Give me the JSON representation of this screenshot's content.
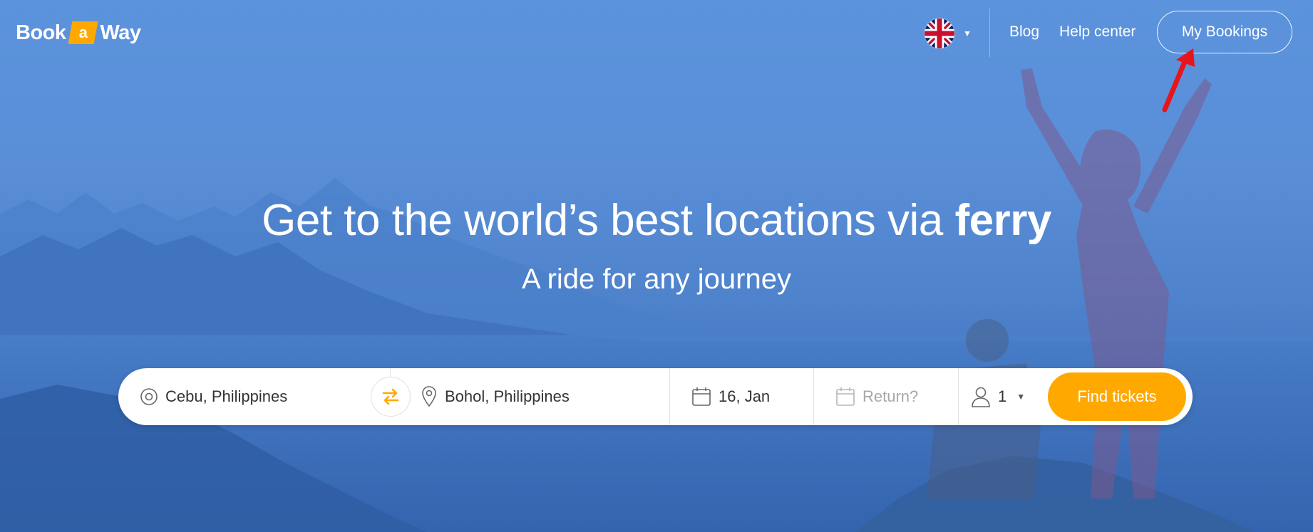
{
  "header": {
    "logo": {
      "part1": "Book",
      "part2": "a",
      "part3": "Way"
    },
    "language": {
      "flag_icon": "uk-flag-icon"
    },
    "nav": {
      "blog": "Blog",
      "help": "Help center",
      "bookings": "My Bookings"
    }
  },
  "hero": {
    "title_main": "Get to the world’s best locations via ",
    "title_bold": "ferry",
    "subtitle": "A ride for any journey"
  },
  "search": {
    "from": "Cebu, Philippines",
    "to": "Bohol, Philippines",
    "depart_date": "16, Jan",
    "return_placeholder": "Return?",
    "passengers": "1",
    "submit": "Find tickets",
    "icons": [
      "origin-circle-icon",
      "swap-arrows-icon",
      "location-pin-icon",
      "calendar-icon",
      "calendar-icon",
      "person-icon",
      "caret-down-icon"
    ]
  },
  "colors": {
    "accent": "#ffa800",
    "hero_blue": "#5a8fd8",
    "annotation_arrow": "#e8141c"
  }
}
